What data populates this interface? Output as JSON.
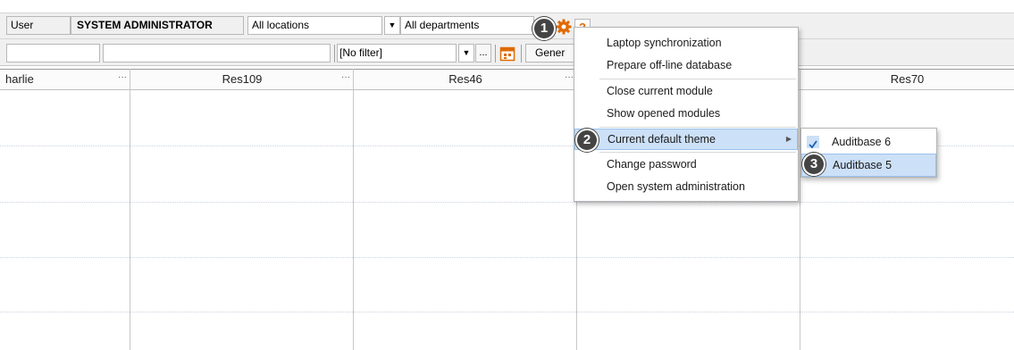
{
  "toolbar": {
    "user_label": "User",
    "user_name": "SYSTEM ADMINISTRATOR",
    "location": "All locations",
    "department": "All departments",
    "filter": "[No filter]",
    "ellipsis": "...",
    "generate_partial": "Gener"
  },
  "grid": {
    "columns": [
      {
        "name": "harlie",
        "dots": "···"
      },
      {
        "name": "Res109",
        "dots": "···"
      },
      {
        "name": "Res46",
        "dots": "···"
      },
      {
        "name": "",
        "dots": ""
      },
      {
        "name": "Res70",
        "dots": ""
      }
    ]
  },
  "menu": {
    "items": [
      {
        "label": "Laptop synchronization"
      },
      {
        "label": "Prepare off-line database"
      },
      {
        "label": "Close current module"
      },
      {
        "label": "Show opened modules"
      },
      {
        "label": "Current default theme",
        "has_submenu": true,
        "highlighted": true
      },
      {
        "label": "Change password"
      },
      {
        "label": "Open system administration"
      }
    ]
  },
  "submenu": {
    "items": [
      {
        "label": "Auditbase 6",
        "checked": true
      },
      {
        "label": "Auditbase 5",
        "highlighted": true
      }
    ]
  },
  "callouts": [
    "1",
    "2",
    "3"
  ],
  "icons": {
    "settings": "gear-icon",
    "help": "help-icon",
    "calendar": "calendar-icon",
    "check": "checkmark-icon"
  },
  "colors": {
    "highlight": "#cce0f7",
    "gear": "#e06a00",
    "badge": "#444444"
  }
}
